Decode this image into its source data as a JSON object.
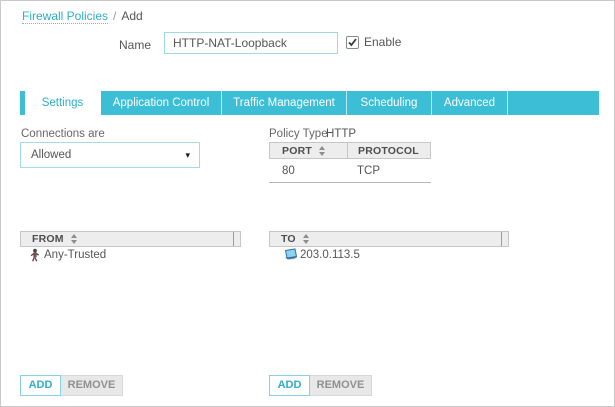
{
  "breadcrumb": {
    "link": "Firewall Policies",
    "separator": "/",
    "current": "Add"
  },
  "form": {
    "name_label": "Name",
    "name_value": "HTTP-NAT-Loopback",
    "enable_label": "Enable",
    "enable_checked": true
  },
  "tabs": [
    {
      "label": "Settings",
      "active": true
    },
    {
      "label": "Application Control",
      "active": false
    },
    {
      "label": "Traffic Management",
      "active": false
    },
    {
      "label": "Scheduling",
      "active": false
    },
    {
      "label": "Advanced",
      "active": false
    }
  ],
  "connections": {
    "label": "Connections are",
    "value": "Allowed"
  },
  "policy_type": {
    "label": "Policy Type",
    "value": "HTTP"
  },
  "port_table": {
    "headers": {
      "port": "PORT",
      "protocol": "PROTOCOL"
    },
    "rows": [
      {
        "port": "80",
        "protocol": "TCP"
      }
    ]
  },
  "from_list": {
    "header": "FROM",
    "items": [
      {
        "label": "Any-Trusted",
        "icon": "any-trusted-alias-icon"
      }
    ],
    "actions": {
      "add": "ADD",
      "remove": "REMOVE"
    }
  },
  "to_list": {
    "header": "TO",
    "items": [
      {
        "label": "203.0.113.5",
        "icon": "host-computer-icon"
      }
    ],
    "actions": {
      "add": "ADD",
      "remove": "REMOVE"
    }
  },
  "colors": {
    "accent_teal": "#3cbfd6",
    "active_tab_text": "#2fafc8",
    "input_border": "#9ed9e6",
    "header_bg": "#ededed",
    "text": "#555555"
  }
}
